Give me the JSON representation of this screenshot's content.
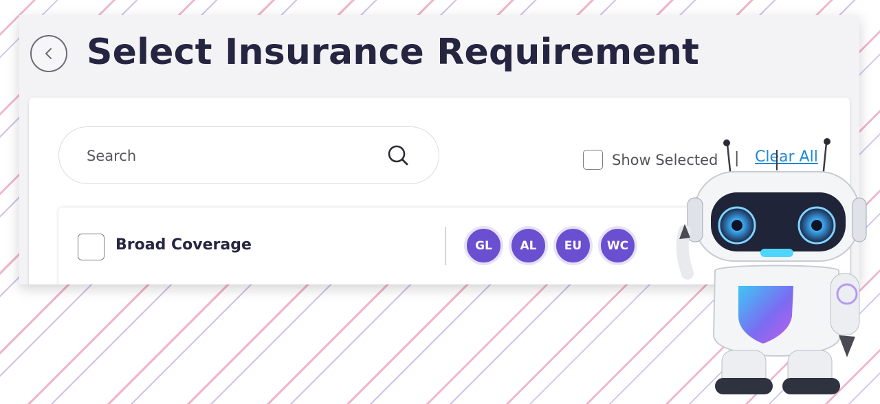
{
  "header": {
    "title": "Select Insurance Requirement"
  },
  "search": {
    "placeholder": "Search",
    "value": ""
  },
  "filters": {
    "show_selected_label": "Show Selected",
    "separator": "|",
    "clear_all_label": "Clear All"
  },
  "requirements": [
    {
      "title": "Broad Coverage",
      "checked": false,
      "tags": [
        "GL",
        "AL",
        "EU",
        "WC"
      ]
    }
  ],
  "colors": {
    "title_text": "#252541",
    "link": "#1f88d6",
    "tag_fill": "#6a4fd0",
    "panel_bg": "#f3f3f5"
  },
  "icons": {
    "back": "chevron-left-icon",
    "search": "search-icon"
  }
}
